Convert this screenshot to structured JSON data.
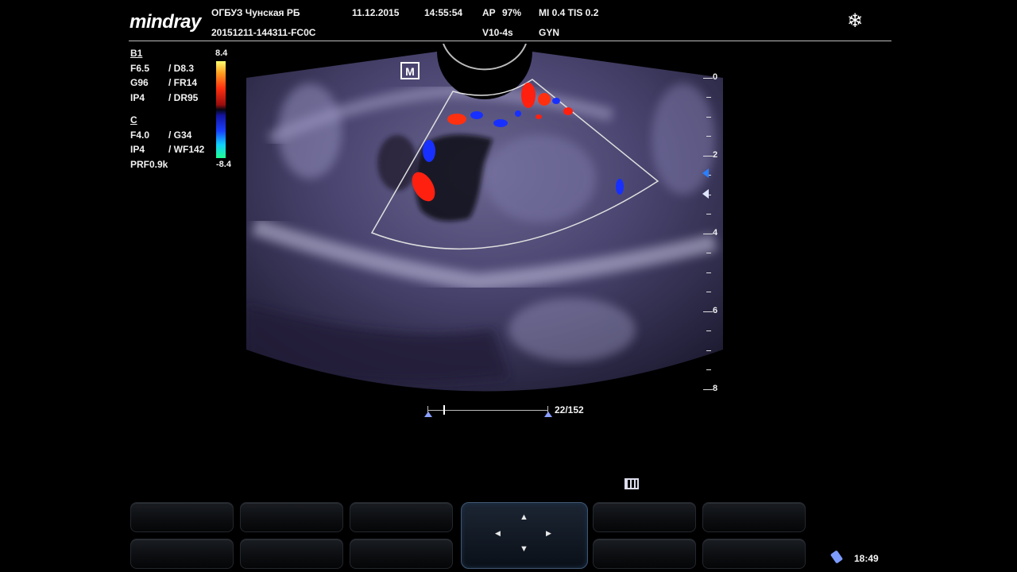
{
  "header": {
    "logo": "mindray",
    "institution": "ОГБУЗ Чунская РБ",
    "patient_id": "20151211-144311-FC0C",
    "date": "11.12.2015",
    "time": "14:55:54",
    "ap": "AP",
    "ap_value": "97%",
    "probe": "V10-4s",
    "mi_tis": "MI 0.4 TIS 0.2",
    "exam": "GYN",
    "freeze_icon": "snowflake-icon"
  },
  "bmode_params": {
    "title": "B1",
    "rows": [
      {
        "a": "F6.5",
        "b": "/ D8.3"
      },
      {
        "a": "G96",
        "b": "/ FR14"
      },
      {
        "a": "IP4",
        "b": "/ DR95"
      }
    ]
  },
  "color_params": {
    "title": "C",
    "rows": [
      {
        "a": "F4.0",
        "b": "/ G34"
      },
      {
        "a": "IP4",
        "b": "/ WF142"
      }
    ],
    "prf": "PRF0.9k"
  },
  "color_scale": {
    "top": "8.4",
    "bottom": "-8.4"
  },
  "image": {
    "orientation_marker": "M"
  },
  "depth_scale": {
    "labels": [
      "0",
      "2",
      "4",
      "6",
      "8"
    ]
  },
  "cine": {
    "frame": "22/152",
    "icon": "film-icon"
  },
  "navpad": {
    "icons": [
      "arrow-up-icon",
      "arrow-down-icon",
      "arrow-left-icon",
      "arrow-right-icon"
    ]
  },
  "status": {
    "clock": "18:49",
    "icon": "usb-drive-icon"
  },
  "colors": {
    "accent": "#3f5670",
    "doppler_red": "#ff2010",
    "doppler_blue": "#1830ff"
  }
}
